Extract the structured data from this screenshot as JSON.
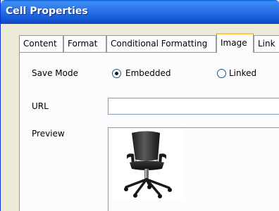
{
  "window": {
    "title": "Cell Properties"
  },
  "tabs": [
    {
      "label": "Content",
      "active": false
    },
    {
      "label": "Format",
      "active": false
    },
    {
      "label": "Conditional Formatting",
      "active": false
    },
    {
      "label": "Image",
      "active": true
    },
    {
      "label": "Link",
      "active": false
    }
  ],
  "form": {
    "save_mode_label": "Save Mode",
    "save_mode_options": [
      {
        "label": "Embedded",
        "selected": true
      },
      {
        "label": "Linked",
        "selected": false
      }
    ],
    "url_label": "URL",
    "url_value": "",
    "preview_label": "Preview",
    "preview_image": "office-chair-image"
  },
  "colors": {
    "titlebar": "#2a72e8",
    "active_tab_accent": "#ffc83c",
    "dialog_bg": "#ece9d8",
    "panel_bg": "#fcfcfe",
    "field_border": "#7f9db9"
  }
}
